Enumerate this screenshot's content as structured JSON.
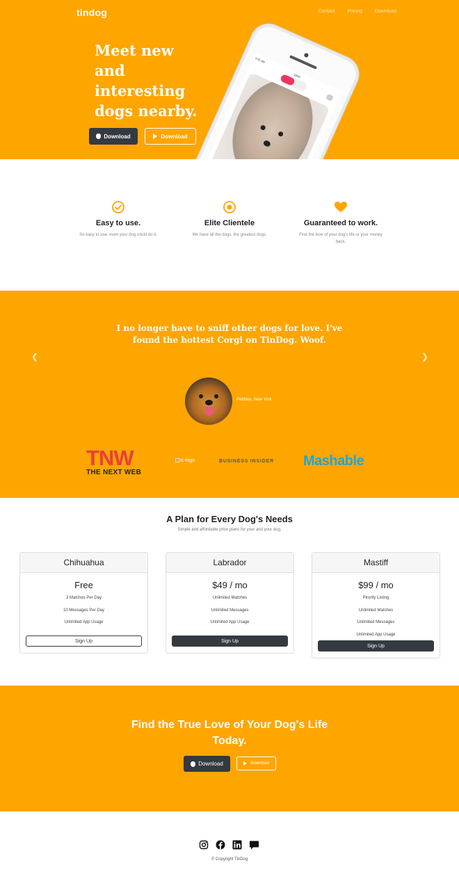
{
  "hero": {
    "brand": "tindog",
    "nav": [
      "Contact",
      "Pricing",
      "Download"
    ],
    "title_lines": [
      "Meet new",
      "and",
      "interesting",
      "dogs nearby."
    ],
    "download_apple": "Download",
    "download_play": "Download",
    "phone_time": "9:41 AM",
    "phone_battery": "100%"
  },
  "features": [
    {
      "icon": "check-circle-icon",
      "title": "Easy to use.",
      "text": "So easy to use, even your dog could do it."
    },
    {
      "icon": "bullseye-icon",
      "title": "Elite Clientele",
      "text": "We have all the dogs, the greatest dogs."
    },
    {
      "icon": "heart-icon",
      "title": "Guaranteed to work.",
      "text": "Find the love of your dog's life or your money back."
    }
  ],
  "testimonial": {
    "quote": "I no longer have to sniff other dogs for love. I've found the hottest Corgi on TinDog. Woof.",
    "author": "Pebbles, New York"
  },
  "press": {
    "tnw_big": "TNW",
    "tnw_small": "THE NEXT WEB",
    "tc_alt": "tc-logo",
    "bi": "BUSINESS INSIDER",
    "mashable": "Mashable"
  },
  "pricing": {
    "title": "A Plan for Every Dog's Needs",
    "subtitle": "Simple and affordable price plans for your and your dog.",
    "plans": [
      {
        "name": "Chihuahua",
        "price": "Free",
        "features": [
          "3 Matches Per Day",
          "10 Messages Per Day",
          "Unlimited App Usage"
        ],
        "button": "Sign Up"
      },
      {
        "name": "Labrador",
        "price": "$49 / mo",
        "features": [
          "Unlimited Matches",
          "Unlimited Messages",
          "Unlimited App Usage"
        ],
        "button": "Sign Up"
      },
      {
        "name": "Mastiff",
        "price": "$99 / mo",
        "features": [
          "Pirority Listing",
          "Unlimited Matches",
          "Unlimited Messages",
          "Unlimited App Usage"
        ],
        "button": "Sign Up"
      }
    ]
  },
  "cta": {
    "title": "Find the True Love of Your Dog's Life Today.",
    "download_apple": "Download",
    "download_play": "Download"
  },
  "footer": {
    "social": [
      "instagram-icon",
      "facebook-icon",
      "linkedin-icon",
      "chat-icon"
    ],
    "copyright": "© Copyright TinDog"
  },
  "colors": {
    "accent": "#FFA500",
    "dark": "#343a40"
  }
}
